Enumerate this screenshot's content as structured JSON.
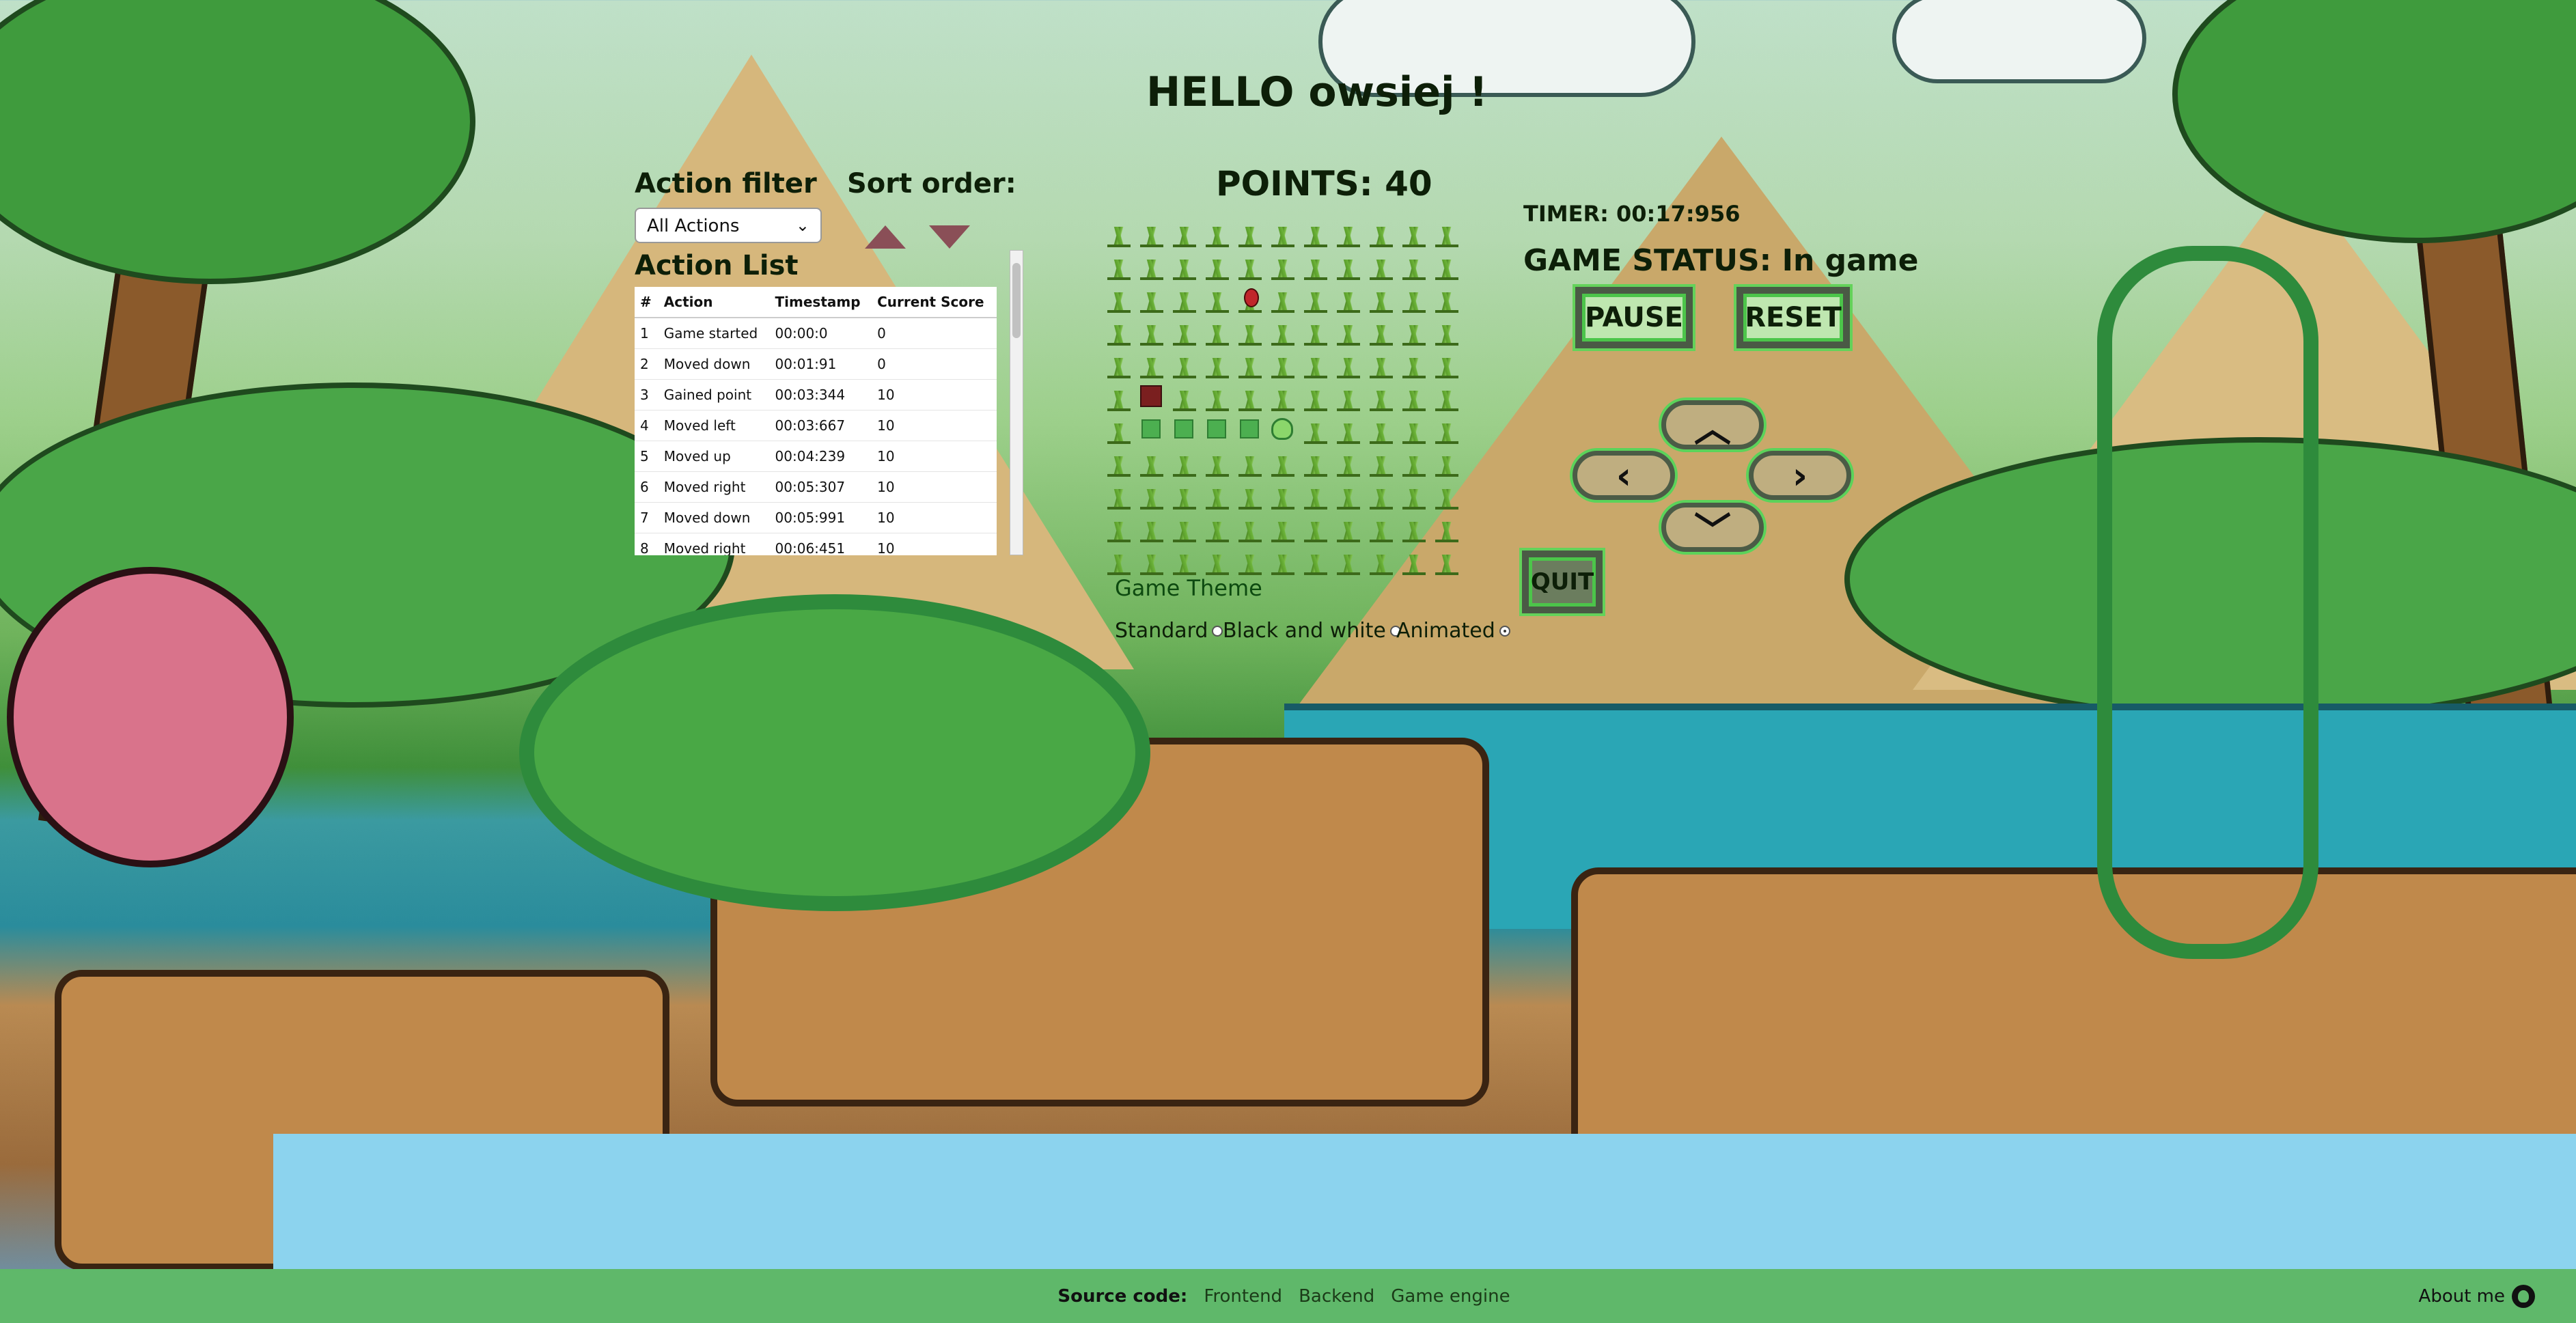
{
  "greeting": "HELLO owsiej !",
  "filter": {
    "label": "Action filter",
    "selected": "All Actions"
  },
  "sort": {
    "label": "Sort order:"
  },
  "action_list": {
    "title": "Action List",
    "columns": [
      "#",
      "Action",
      "Timestamp",
      "Current Score"
    ],
    "rows": [
      [
        "1",
        "Game started",
        "00:00:0",
        "0"
      ],
      [
        "2",
        "Moved down",
        "00:01:91",
        "0"
      ],
      [
        "3",
        "Gained point",
        "00:03:344",
        "10"
      ],
      [
        "4",
        "Moved left",
        "00:03:667",
        "10"
      ],
      [
        "5",
        "Moved up",
        "00:04:239",
        "10"
      ],
      [
        "6",
        "Moved right",
        "00:05:307",
        "10"
      ],
      [
        "7",
        "Moved down",
        "00:05:991",
        "10"
      ],
      [
        "8",
        "Moved right",
        "00:06:451",
        "10"
      ]
    ]
  },
  "points": "POINTS: 40",
  "timer": "TIMER: 00:17:956",
  "status": "GAME STATUS: In game",
  "buttons": {
    "pause": "PAUSE",
    "reset": "RESET",
    "quit": "QUIT",
    "up": "^",
    "down": "v",
    "left": "<",
    "right": ">"
  },
  "theme": {
    "title": "Game Theme",
    "options": [
      "Standard",
      "Black and white",
      "Animated"
    ],
    "selected": "Animated"
  },
  "footer": {
    "source_label": "Source code:",
    "links": [
      "Frontend",
      "Backend",
      "Game engine"
    ],
    "about": "About me"
  },
  "icons": {
    "sort_asc": "triangle-up-icon",
    "sort_desc": "triangle-down-icon",
    "github": "github-icon"
  },
  "colors": {
    "footer_bg": "#5fb86a",
    "sort_arrow": "#8a4f57",
    "snake": "#4caf50",
    "food": "#c0262b"
  }
}
